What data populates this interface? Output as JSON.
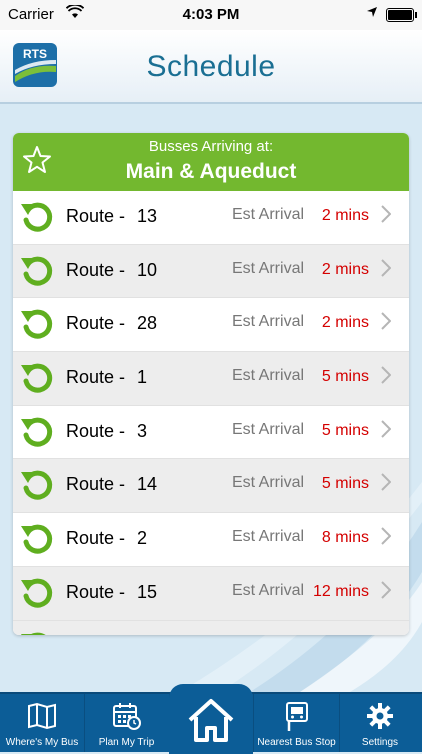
{
  "status_bar": {
    "carrier": "Carrier",
    "time": "4:03 PM"
  },
  "header": {
    "logo_text": "RTS",
    "title": "Schedule"
  },
  "stop": {
    "subtitle": "Busses Arriving at:",
    "name": "Main & Aqueduct"
  },
  "rows": [
    {
      "label": "Route -",
      "route": "13",
      "est": "Est Arrival",
      "eta": "2 mins"
    },
    {
      "label": "Route -",
      "route": "10",
      "est": "Est Arrival",
      "eta": "2 mins"
    },
    {
      "label": "Route -",
      "route": "28",
      "est": "Est Arrival",
      "eta": "2 mins"
    },
    {
      "label": "Route -",
      "route": "1",
      "est": "Est Arrival",
      "eta": "5 mins"
    },
    {
      "label": "Route -",
      "route": "3",
      "est": "Est Arrival",
      "eta": "5 mins"
    },
    {
      "label": "Route -",
      "route": "14",
      "est": "Est Arrival",
      "eta": "5 mins"
    },
    {
      "label": "Route -",
      "route": "2",
      "est": "Est Arrival",
      "eta": "8 mins"
    },
    {
      "label": "Route -",
      "route": "15",
      "est": "Est Arrival",
      "eta": "12 mins"
    }
  ],
  "tabs": {
    "wheres_my_bus": "Where's My Bus",
    "plan_my_trip": "Plan My Trip",
    "nearest_bus_stop": "Nearest Bus Stop",
    "settings": "Settings"
  },
  "colors": {
    "accent_green": "#73b82f",
    "eta_red": "#d40000",
    "tab_blue": "#0c5d97"
  }
}
